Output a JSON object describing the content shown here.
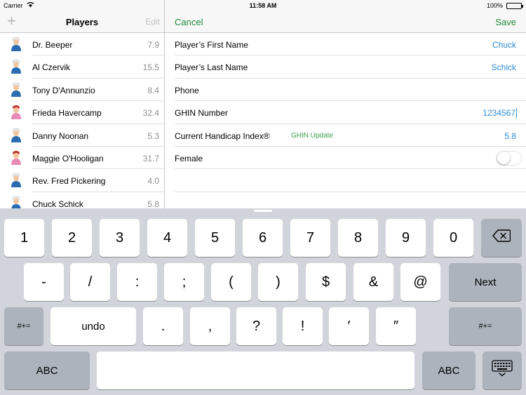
{
  "status_bar": {
    "carrier": "Carrier",
    "time": "11:58 AM",
    "battery": "100%"
  },
  "left": {
    "add_icon": "plus-icon",
    "title": "Players",
    "edit_label": "Edit",
    "players": [
      {
        "name": "Dr. Beeper",
        "handicap": "7.9",
        "gender": "male"
      },
      {
        "name": "Al Czervik",
        "handicap": "15.5",
        "gender": "male"
      },
      {
        "name": "Tony D'Annunzio",
        "handicap": "8.4",
        "gender": "male"
      },
      {
        "name": "Frieda Havercamp",
        "handicap": "32.4",
        "gender": "female"
      },
      {
        "name": "Danny Noonan",
        "handicap": "5.3",
        "gender": "male"
      },
      {
        "name": "Maggie O'Hooligan",
        "handicap": "31.7",
        "gender": "female"
      },
      {
        "name": "Rev. Fred Pickering",
        "handicap": "4.0",
        "gender": "male"
      },
      {
        "name": "Chuck Schick",
        "handicap": "5.8",
        "gender": "male"
      }
    ]
  },
  "right": {
    "cancel_label": "Cancel",
    "save_label": "Save",
    "fields": {
      "first_name": {
        "label": "Player’s First Name",
        "value": "Chuck"
      },
      "last_name": {
        "label": "Player’s Last Name",
        "value": "Schick"
      },
      "phone": {
        "label": "Phone",
        "value": ""
      },
      "ghin": {
        "label": "GHIN Number",
        "value": "1234567"
      },
      "handicap": {
        "label": "Current Handicap Index®",
        "button": "GHIN Update",
        "value": "5.8"
      },
      "female": {
        "label": "Female",
        "on": false
      }
    }
  },
  "colors": {
    "accent_green": "#1f8a3c",
    "value_blue": "#2d8cd6",
    "keyboard_bg": "#d1d5db",
    "dark_key": "#acb3bc"
  },
  "keyboard": {
    "row1": [
      "1",
      "2",
      "3",
      "4",
      "5",
      "6",
      "7",
      "8",
      "9",
      "0"
    ],
    "delete_icon": "backspace-icon",
    "row2": [
      "-",
      "/",
      ":",
      ";",
      "(",
      ")",
      "$",
      "&",
      "@"
    ],
    "next": "Next",
    "sym_left": "#+=",
    "undo": "undo",
    "row3": [
      ".",
      ",",
      "?",
      "!",
      "′",
      "″"
    ],
    "sym_right": "#+=",
    "abc_left": "ABC",
    "abc_right": "ABC",
    "dismiss_icon": "keyboard-dismiss-icon"
  }
}
